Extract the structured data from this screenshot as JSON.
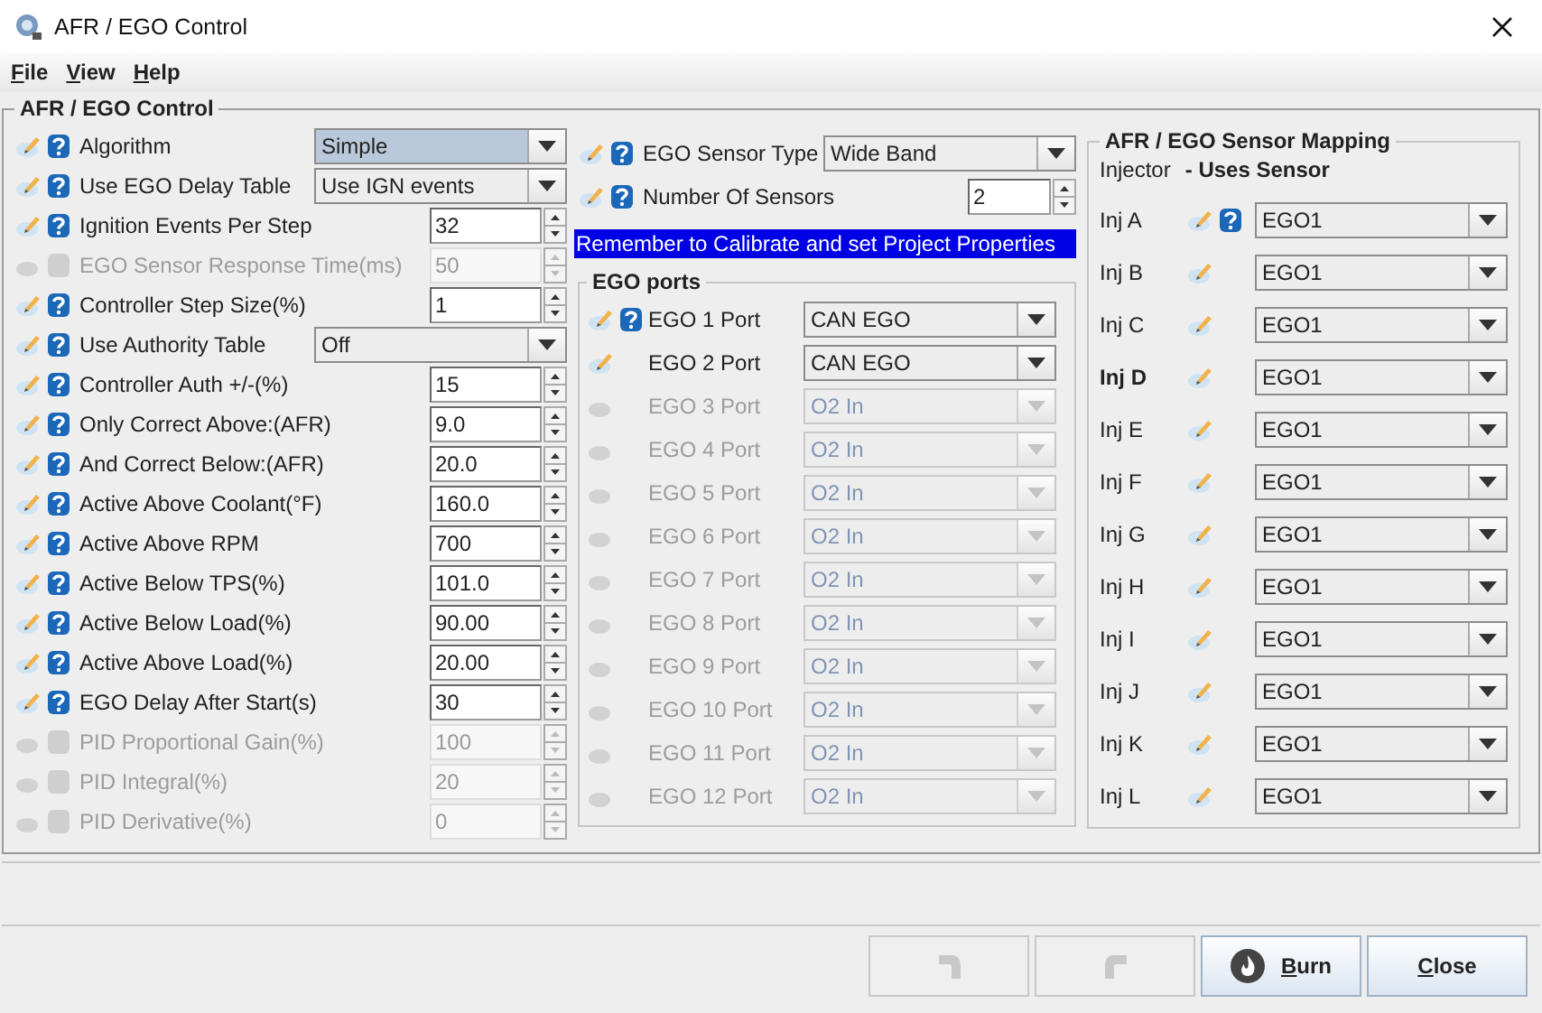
{
  "window": {
    "title": "AFR / EGO Control"
  },
  "menu": [
    {
      "label": "File"
    },
    {
      "label": "View"
    },
    {
      "label": "Help"
    }
  ],
  "panel": {
    "title": "AFR / EGO Control"
  },
  "settings": [
    {
      "kind": "combo",
      "label": "Algorithm",
      "value": "Simple",
      "disabled": false,
      "focused": true
    },
    {
      "kind": "combo",
      "label": "Use EGO Delay Table",
      "value": "Use IGN events",
      "disabled": false,
      "focused": false
    },
    {
      "kind": "spinner",
      "label": "Ignition Events Per Step",
      "value": "32",
      "disabled": false
    },
    {
      "kind": "spinner",
      "label": "EGO Sensor Response Time(ms)",
      "value": "50",
      "disabled": true
    },
    {
      "kind": "spinner",
      "label": "Controller Step Size(%)",
      "value": "1",
      "disabled": false
    },
    {
      "kind": "combo",
      "label": "Use Authority Table",
      "value": "Off",
      "disabled": false,
      "focused": false
    },
    {
      "kind": "spinner",
      "label": "Controller Auth +/-(%)",
      "value": "15",
      "disabled": false
    },
    {
      "kind": "spinner",
      "label": "Only Correct Above:(AFR)",
      "value": "9.0",
      "disabled": false
    },
    {
      "kind": "spinner",
      "label": "And Correct Below:(AFR)",
      "value": "20.0",
      "disabled": false
    },
    {
      "kind": "spinner",
      "label": "Active Above Coolant(°F)",
      "value": "160.0",
      "disabled": false
    },
    {
      "kind": "spinner",
      "label": "Active Above RPM",
      "value": "700",
      "disabled": false
    },
    {
      "kind": "spinner",
      "label": "Active Below TPS(%)",
      "value": "101.0",
      "disabled": false
    },
    {
      "kind": "spinner",
      "label": "Active Below Load(%)",
      "value": "90.00",
      "disabled": false
    },
    {
      "kind": "spinner",
      "label": "Active Above Load(%)",
      "value": "20.00",
      "disabled": false
    },
    {
      "kind": "spinner",
      "label": "EGO Delay After Start(s)",
      "value": "30",
      "disabled": false
    },
    {
      "kind": "spinner",
      "label": "PID Proportional Gain(%)",
      "value": "100",
      "disabled": true
    },
    {
      "kind": "spinner",
      "label": "PID Integral(%)",
      "value": "20",
      "disabled": true
    },
    {
      "kind": "spinner",
      "label": "PID Derivative(%)",
      "value": "0",
      "disabled": true
    }
  ],
  "sensor": [
    {
      "kind": "combo",
      "label": "EGO Sensor Type",
      "value": "Wide Band",
      "disabled": false
    },
    {
      "kind": "spinner",
      "label": "Number Of Sensors",
      "value": "2",
      "disabled": false
    }
  ],
  "notice": "Remember to Calibrate and set Project Properties",
  "ego_ports": {
    "title": "EGO ports",
    "ports": [
      {
        "label": "EGO 1 Port",
        "value": "CAN EGO",
        "disabled": false,
        "help": true
      },
      {
        "label": "EGO 2 Port",
        "value": "CAN EGO",
        "disabled": false,
        "help": false
      },
      {
        "label": "EGO 3 Port",
        "value": "O2 In",
        "disabled": true,
        "help": false
      },
      {
        "label": "EGO 4 Port",
        "value": "O2 In",
        "disabled": true,
        "help": false
      },
      {
        "label": "EGO 5 Port",
        "value": "O2 In",
        "disabled": true,
        "help": false
      },
      {
        "label": "EGO 6 Port",
        "value": "O2 In",
        "disabled": true,
        "help": false
      },
      {
        "label": "EGO 7 Port",
        "value": "O2 In",
        "disabled": true,
        "help": false
      },
      {
        "label": "EGO 8 Port",
        "value": "O2 In",
        "disabled": true,
        "help": false
      },
      {
        "label": "EGO 9 Port",
        "value": "O2 In",
        "disabled": true,
        "help": false
      },
      {
        "label": "EGO 10 Port",
        "value": "O2 In",
        "disabled": true,
        "help": false
      },
      {
        "label": "EGO 11 Port",
        "value": "O2 In",
        "disabled": true,
        "help": false
      },
      {
        "label": "EGO 12 Port",
        "value": "O2 In",
        "disabled": true,
        "help": false
      }
    ]
  },
  "mapping": {
    "title": "AFR / EGO Sensor Mapping",
    "header_injector": "Injector",
    "header_sensor": "- Uses Sensor",
    "injectors": [
      {
        "label": "Inj A",
        "value": "EGO1",
        "bold": false,
        "help": true
      },
      {
        "label": "Inj B",
        "value": "EGO1",
        "bold": false,
        "help": false
      },
      {
        "label": "Inj C",
        "value": "EGO1",
        "bold": false,
        "help": false
      },
      {
        "label": "Inj D",
        "value": "EGO1",
        "bold": true,
        "help": false
      },
      {
        "label": "Inj E",
        "value": "EGO1",
        "bold": false,
        "help": false
      },
      {
        "label": "Inj F",
        "value": "EGO1",
        "bold": false,
        "help": false
      },
      {
        "label": "Inj G",
        "value": "EGO1",
        "bold": false,
        "help": false
      },
      {
        "label": "Inj H",
        "value": "EGO1",
        "bold": false,
        "help": false
      },
      {
        "label": "Inj I",
        "value": "EGO1",
        "bold": false,
        "help": false
      },
      {
        "label": "Inj J",
        "value": "EGO1",
        "bold": false,
        "help": false
      },
      {
        "label": "Inj K",
        "value": "EGO1",
        "bold": false,
        "help": false
      },
      {
        "label": "Inj L",
        "value": "EGO1",
        "bold": false,
        "help": false
      }
    ]
  },
  "buttons": [
    {
      "kind": "undo",
      "disabled": true
    },
    {
      "kind": "redo",
      "disabled": true
    },
    {
      "kind": "burn",
      "label": "Burn",
      "disabled": false
    },
    {
      "kind": "close",
      "label": "Close",
      "disabled": false
    }
  ]
}
